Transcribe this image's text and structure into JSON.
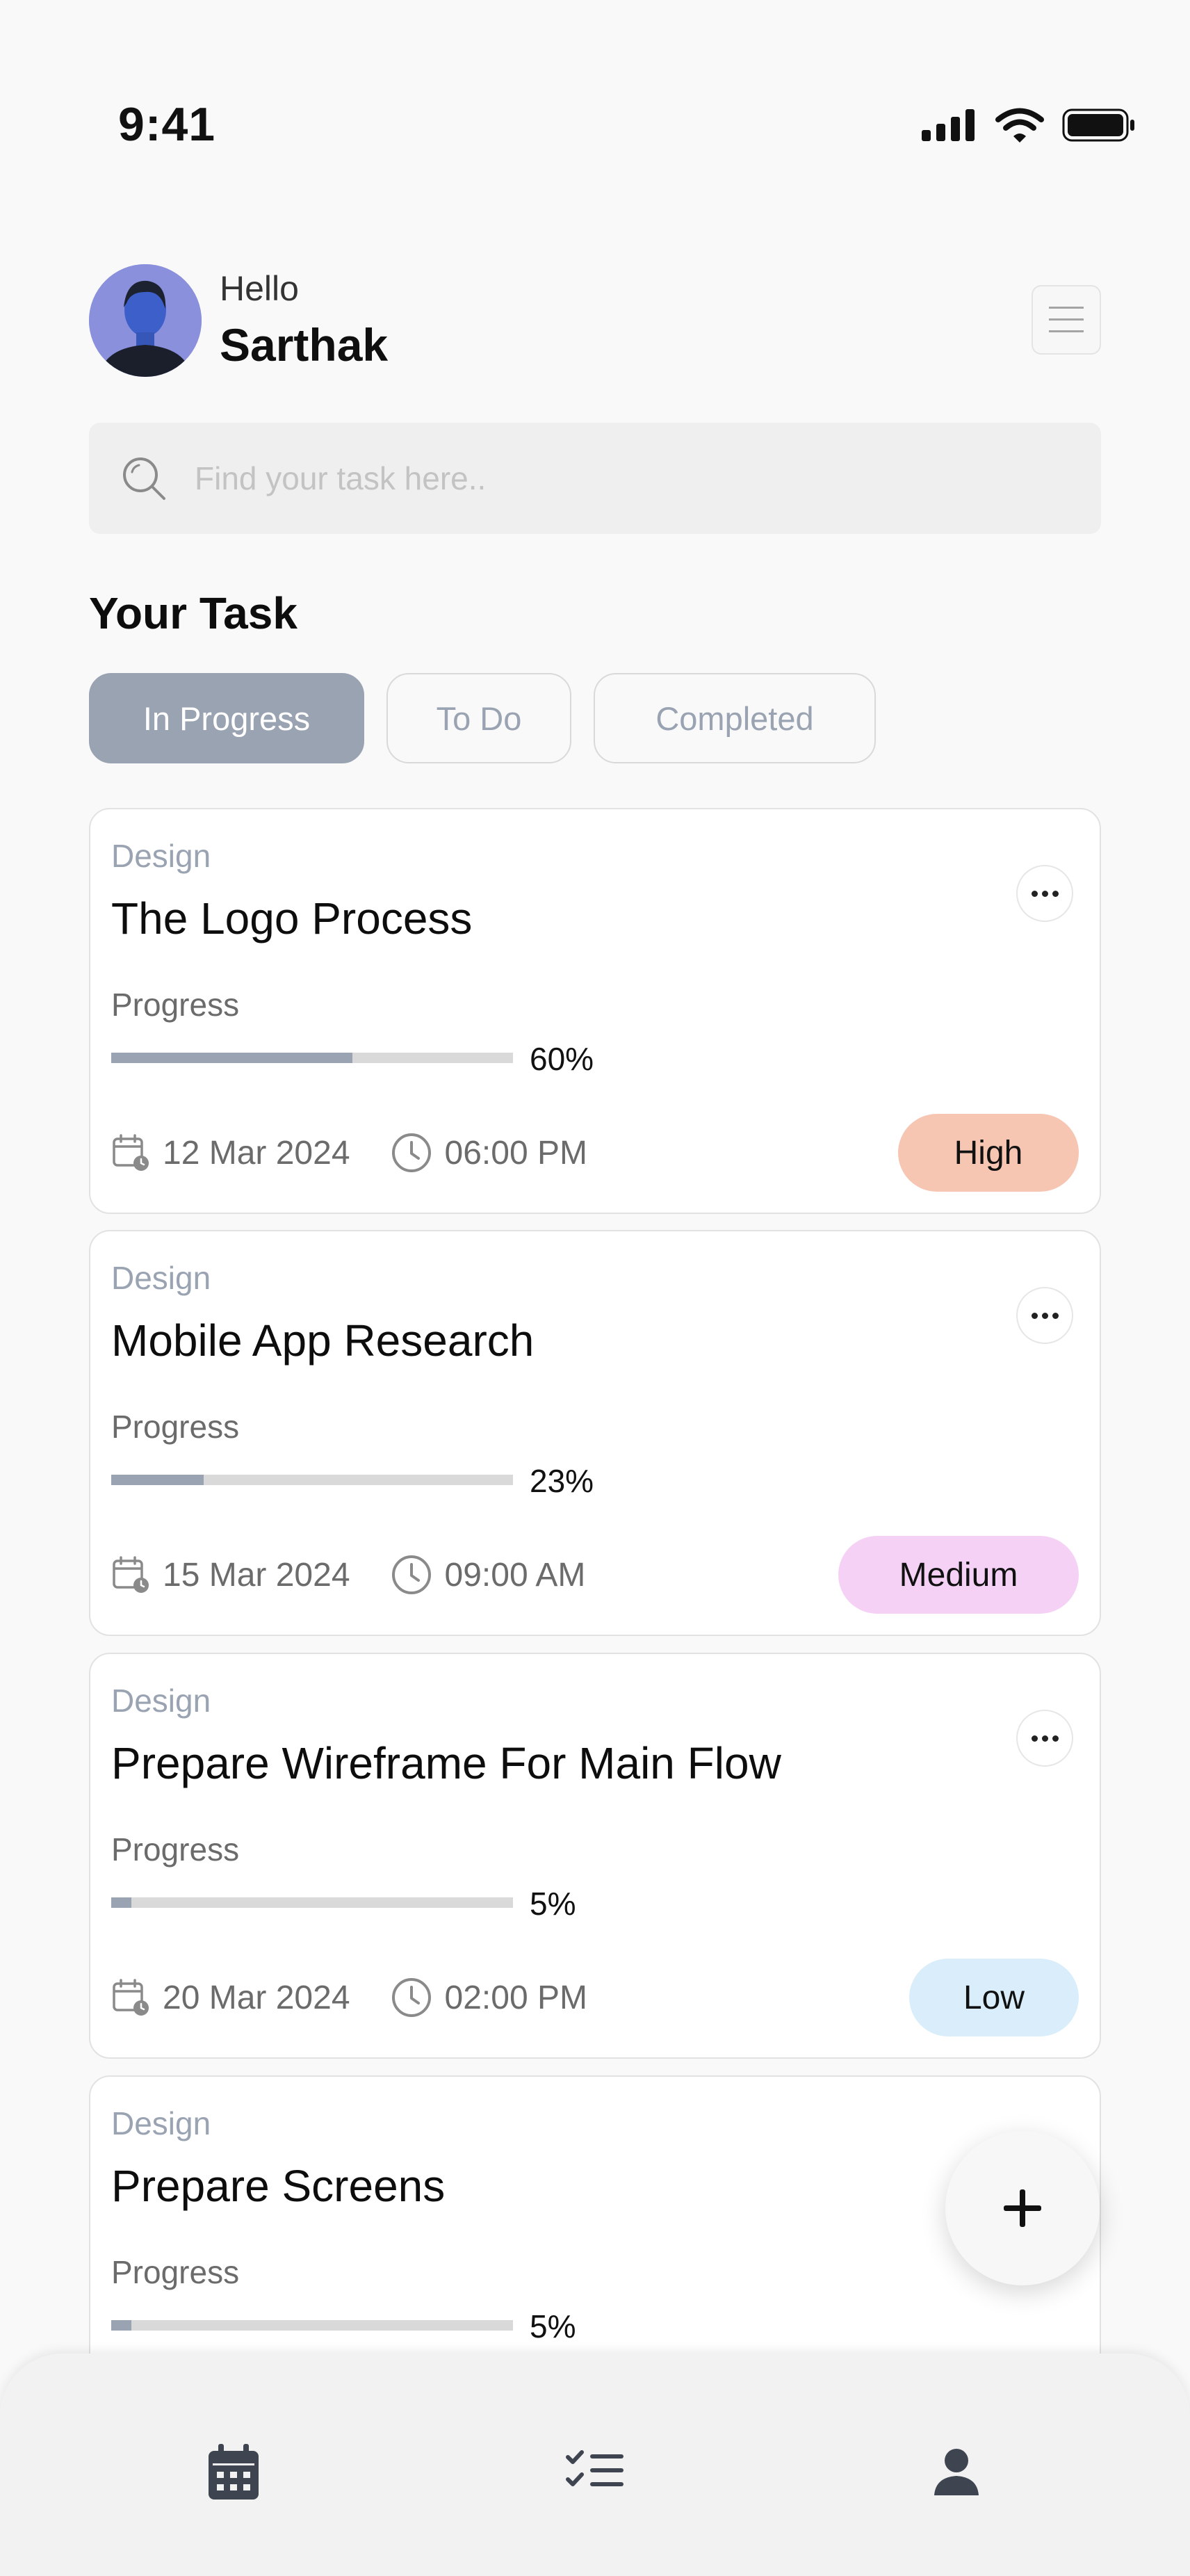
{
  "status_bar": {
    "time": "9:41"
  },
  "header": {
    "greeting": "Hello",
    "user_name": "Sarthak",
    "menu_icon": "hamburger-menu-icon"
  },
  "search": {
    "placeholder": "Find your task here..",
    "icon": "search-icon"
  },
  "section_title": "Your Task",
  "tabs": [
    {
      "label": "In Progress",
      "active": true
    },
    {
      "label": "To Do",
      "active": false
    },
    {
      "label": "Completed",
      "active": false
    }
  ],
  "tasks": [
    {
      "category": "Design",
      "title": "The Logo Process",
      "progress_label": "Progress",
      "progress": 60,
      "progress_text": "60%",
      "date": "12 Mar 2024",
      "time": "06:00 PM",
      "priority": "High",
      "priority_color": "#f7c6b3"
    },
    {
      "category": "Design",
      "title": "Mobile App Research",
      "progress_label": "Progress",
      "progress": 23,
      "progress_text": "23%",
      "date": "15 Mar 2024",
      "time": "09:00 AM",
      "priority": "Medium",
      "priority_color": "#f5d2f5"
    },
    {
      "category": "Design",
      "title": "Prepare Wireframe For Main Flow",
      "progress_label": "Progress",
      "progress": 5,
      "progress_text": "5%",
      "date": "20 Mar 2024",
      "time": "02:00 PM",
      "priority": "Low",
      "priority_color": "#d9eefa"
    },
    {
      "category": "Design",
      "title": "Prepare Screens",
      "progress_label": "Progress",
      "progress": 5,
      "progress_text": "5%"
    }
  ],
  "fab": {
    "icon": "plus-icon"
  },
  "bottom_nav": [
    {
      "icon": "calendar-icon"
    },
    {
      "icon": "task-list-icon"
    },
    {
      "icon": "profile-icon"
    }
  ],
  "colors": {
    "accent": "#9aa3b2",
    "background": "#f9f9f9",
    "card": "#ffffff"
  }
}
